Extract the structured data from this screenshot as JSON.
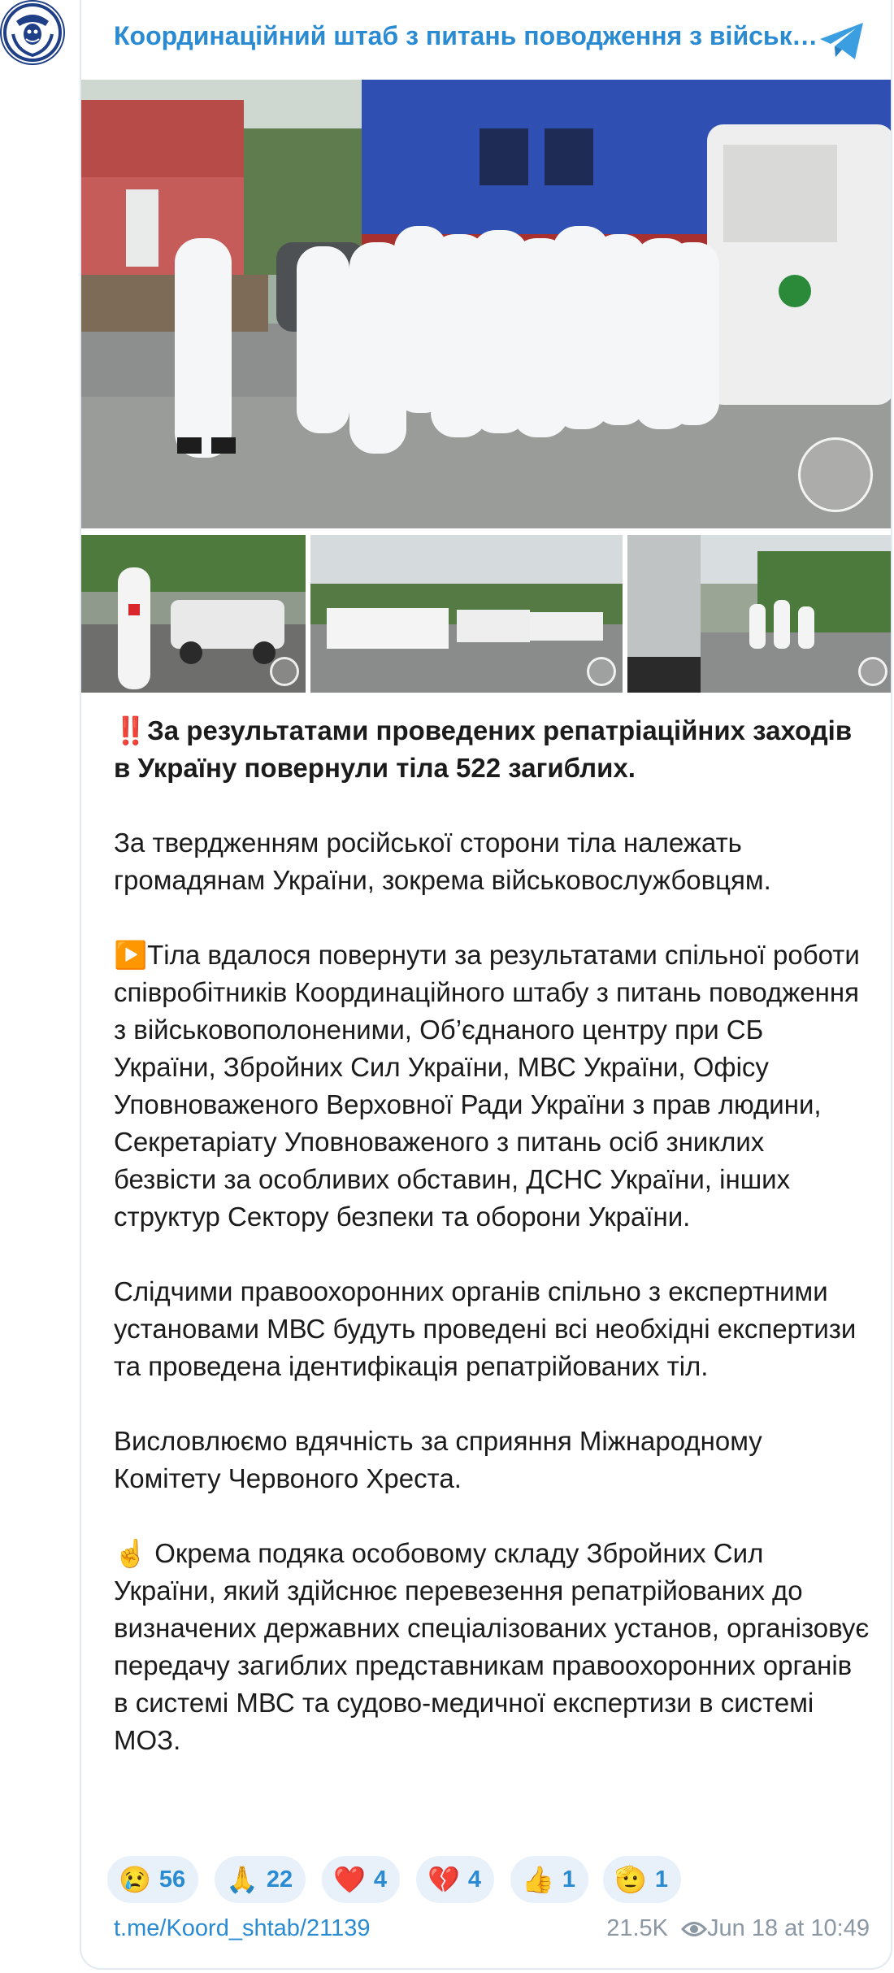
{
  "channel": {
    "title": "Координаційний штаб з питань поводження з військовополоненими",
    "avatar_icon": "emblem-icon",
    "share_icon": "telegram-icon"
  },
  "media": {
    "main_photo": "group-in-protective-suits-photo",
    "thumbs": [
      "red-cross-worker-photo",
      "trucks-on-road-photo",
      "truck-and-walkers-photo"
    ],
    "watermark_icon": "emblem-watermark-icon"
  },
  "message": {
    "p1_emoji": "‼️",
    "p1": "За результатами проведених репатріаційних заходів в Україну повернули тіла 522 загиблих.",
    "p2": "За твердженням російської сторони тіла належать громадянам України, зокрема військовослужбовцям.",
    "p3_emoji": "▶️",
    "p3": "Тіла вдалося повернути за результатами спільної роботи співробітників Координаційного штабу з питань поводження з військовополоненими, Об’єднаного центру при СБ України, Збройних Сил України, МВС України, Офісу Уповноваженого Верховної Ради України з прав людини, Секретаріату Уповноваженого з питань осіб зниклих безвісти за особливих обставин, ДСНС України, інших структур Сектору безпеки та оборони України.",
    "p4": "Слідчими правоохоронних органів спільно з експертними установами МВС будуть проведені всі необхідні експертизи та проведена ідентифікація репатрійованих тіл.",
    "p5": "Висловлюємо вдячність за сприяння Міжнародному Комітету Червоного Хреста.",
    "p6_emoji": "☝️",
    "p6": "Окрема подяка особовому складу Збройних Сил України, який здійснює перевезення репатрійованих до визначених державних спеціалізованих установ, організовує передачу загиблих представникам правоохоронних органів в системі МВС та судово-медичної експертизи в системі МОЗ."
  },
  "reactions": [
    {
      "emoji": "😢",
      "count": "56"
    },
    {
      "emoji": "🙏",
      "count": "22"
    },
    {
      "emoji": "❤️",
      "count": "4"
    },
    {
      "emoji": "💔",
      "count": "4"
    },
    {
      "emoji": "👍",
      "count": "1"
    },
    {
      "emoji": "🫡",
      "count": "1"
    }
  ],
  "footer": {
    "link": "t.me/Koord_shtab/21139",
    "views": "21.5K",
    "views_icon": "eye-icon",
    "date": "Jun 18 at 10:49"
  },
  "colors": {
    "accent": "#2a8bd3",
    "reaction_bg": "#e8f1fa",
    "meta": "#8b97a3"
  }
}
